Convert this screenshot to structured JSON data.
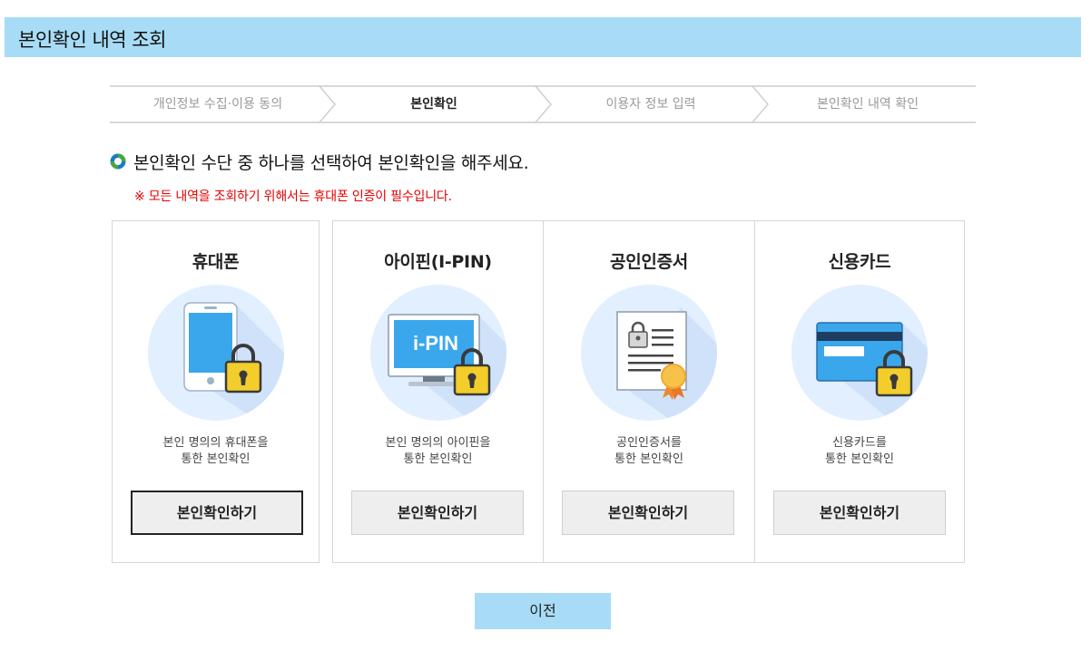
{
  "window": {
    "title": "본인확인 내역 조회"
  },
  "steps": [
    {
      "label": "개인정보 수집·이용 동의"
    },
    {
      "label": "본인확인"
    },
    {
      "label": "이용자 정보 입력"
    },
    {
      "label": "본인확인 내역 확인"
    }
  ],
  "active_step": 1,
  "main": {
    "heading": "본인확인 수단 중 하나를 선택하여 본인확인을 해주세요.",
    "notice": "※ 모든 내역을 조회하기 위해서는 휴대폰 인증이 필수입니다."
  },
  "methods": [
    {
      "title": "휴대폰",
      "desc1": "본인 명의의 휴대폰을",
      "desc2": "통한 본인확인",
      "button": "본인확인하기",
      "icon": "phone-lock-icon"
    },
    {
      "title": "아이핀(I-PIN)",
      "desc1": "본인 명의의 아이핀을",
      "desc2": "통한 본인확인",
      "button": "본인확인하기",
      "icon": "ipin-monitor-lock-icon",
      "screen_text": "i-PIN"
    },
    {
      "title": "공인인증서",
      "desc1": "공인인증서를",
      "desc2": "통한 본인확인",
      "button": "본인확인하기",
      "icon": "certificate-icon"
    },
    {
      "title": "신용카드",
      "desc1": "신용카드를",
      "desc2": "통한 본인확인",
      "button": "본인확인하기",
      "icon": "credit-card-lock-icon"
    }
  ],
  "footer": {
    "prev_label": "이전"
  },
  "colors": {
    "title_bar": "#a8dcf6",
    "notice": "#e60000",
    "icon_circle": "#e2efff",
    "lock": "#f2cd2b",
    "screen_blue": "#3aa7ec"
  }
}
